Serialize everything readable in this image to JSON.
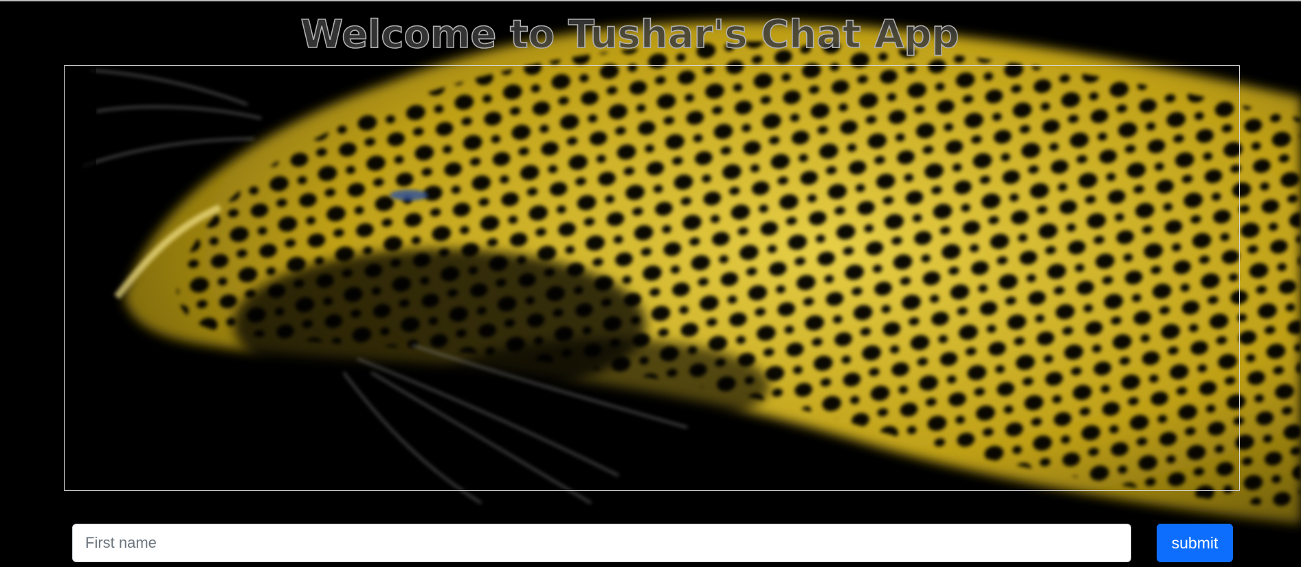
{
  "header": {
    "title": "Welcome to Tushar's Chat App"
  },
  "background": {
    "subject": "leopard-image",
    "colors": {
      "base": "#000000",
      "fur": "#d8b820",
      "fur_light": "#f2e27a",
      "spots": "#000000"
    }
  },
  "form": {
    "name_input": {
      "value": "",
      "placeholder": "First name"
    },
    "submit_label": "submit"
  },
  "colors": {
    "accent": "#0d6efd",
    "chat_box_border": "#d8d8d8"
  }
}
